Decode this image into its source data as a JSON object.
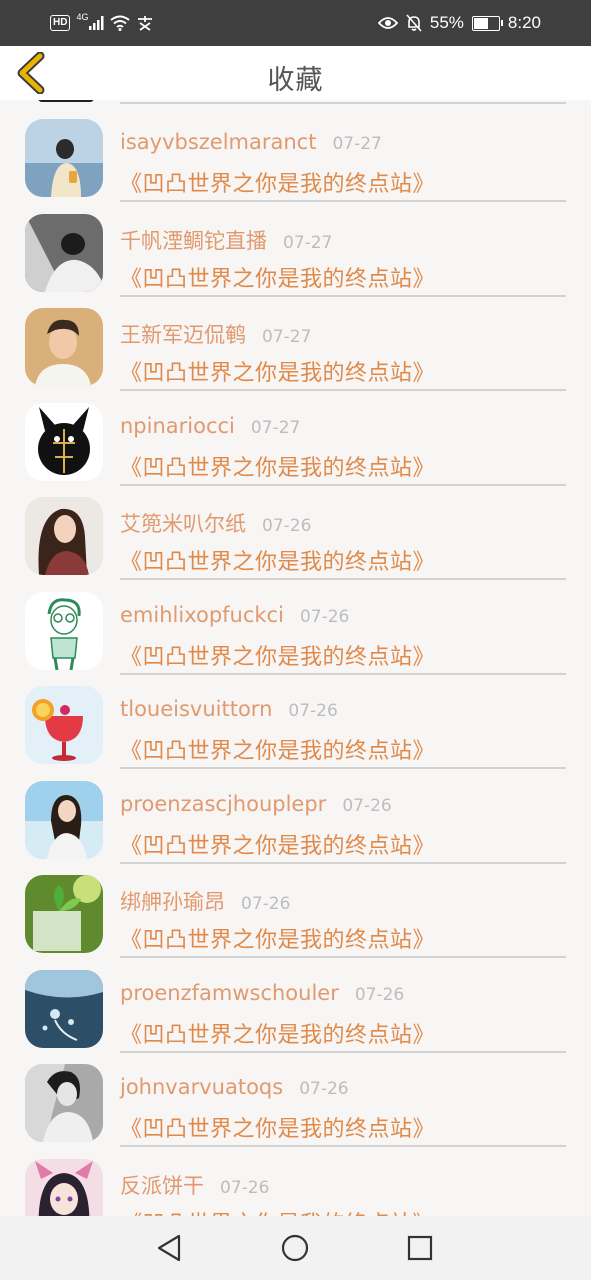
{
  "status_bar": {
    "hd": "HD",
    "network": "4G",
    "battery": "55%",
    "battery_level": 0.55,
    "time": "8:20"
  },
  "header": {
    "title": "收藏"
  },
  "favorites": [
    {
      "user": "isayvbszelmaranct",
      "date": "07-27",
      "title": "《凹凸世界之你是我的终点站》",
      "avatar": "woman-beach"
    },
    {
      "user": "千帆湮鲷铊直播",
      "date": "07-27",
      "title": "《凹凸世界之你是我的终点站》",
      "avatar": "man-bw"
    },
    {
      "user": "王新军迈侃鹌",
      "date": "07-27",
      "title": "《凹凸世界之你是我的终点站》",
      "avatar": "young-man"
    },
    {
      "user": "npinariocci",
      "date": "07-27",
      "title": "《凹凸世界之你是我的终点站》",
      "avatar": "black-rabbit"
    },
    {
      "user": "艾篼米叭尔纸",
      "date": "07-26",
      "title": "《凹凸世界之你是我的终点站》",
      "avatar": "woman-longhair"
    },
    {
      "user": "emihlixopfuckci",
      "date": "07-26",
      "title": "《凹凸世界之你是我的终点站》",
      "avatar": "sketch-boy"
    },
    {
      "user": "tloueisvuittorn",
      "date": "07-26",
      "title": "《凹凸世界之你是我的终点站》",
      "avatar": "cocktail"
    },
    {
      "user": "proenzascjhouplepr",
      "date": "07-26",
      "title": "《凹凸世界之你是我的终点站》",
      "avatar": "girl-sky"
    },
    {
      "user": "绑舺孙瑜昂",
      "date": "07-26",
      "title": "《凹凸世界之你是我的终点站》",
      "avatar": "plant-glass"
    },
    {
      "user": "proenzfamwschouler",
      "date": "07-26",
      "title": "《凹凸世界之你是我的终点站》",
      "avatar": "underwater"
    },
    {
      "user": "johnvarvuatoqs",
      "date": "07-26",
      "title": "《凹凸世界之你是我的终点站》",
      "avatar": "woman-bw"
    },
    {
      "user": "反派饼干",
      "date": "07-26",
      "title": "《凹凸世界之你是我的终点站》",
      "avatar": "anime-girl"
    }
  ],
  "colors": {
    "username": "#e19a6e",
    "title": "#e08a4a",
    "date": "#bdbdbd",
    "back_arrow": "#e8b400"
  },
  "icons": {
    "back": "chevron-left-icon",
    "nav_back": "triangle-back-icon",
    "nav_home": "circle-home-icon",
    "nav_recents": "square-recents-icon"
  }
}
